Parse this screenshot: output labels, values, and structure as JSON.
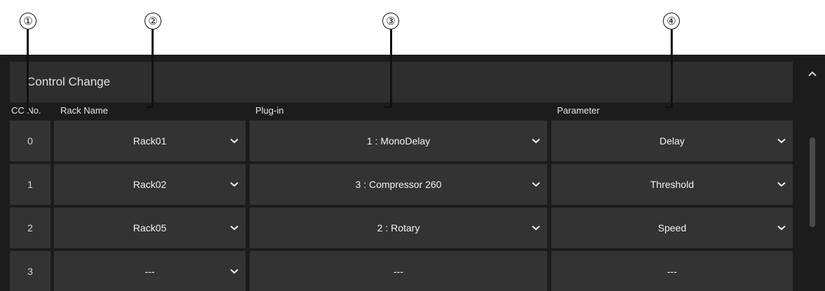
{
  "callouts": [
    "①",
    "②",
    "③",
    "④"
  ],
  "section": {
    "title": "Control Change"
  },
  "columns": {
    "cc": "CC No.",
    "rack": "Rack Name",
    "plugin": "Plug-in",
    "param": "Parameter"
  },
  "rows": [
    {
      "cc": "0",
      "rack": "Rack01",
      "plugin": "1 : MonoDelay",
      "param": "Delay"
    },
    {
      "cc": "1",
      "rack": "Rack02",
      "plugin": "3 : Compressor 260",
      "param": "Threshold"
    },
    {
      "cc": "2",
      "rack": "Rack05",
      "plugin": "2 : Rotary",
      "param": "Speed"
    },
    {
      "cc": "3",
      "rack": "---",
      "plugin": "---",
      "param": "---"
    }
  ],
  "icons": {
    "dropdown": "chevron-down-icon",
    "scroll": "chevron-up-icon"
  },
  "colors": {
    "panel": "#1c1c1c",
    "cell": "#333333",
    "header": "#2e2e2e",
    "text": "#f2f2f2"
  }
}
